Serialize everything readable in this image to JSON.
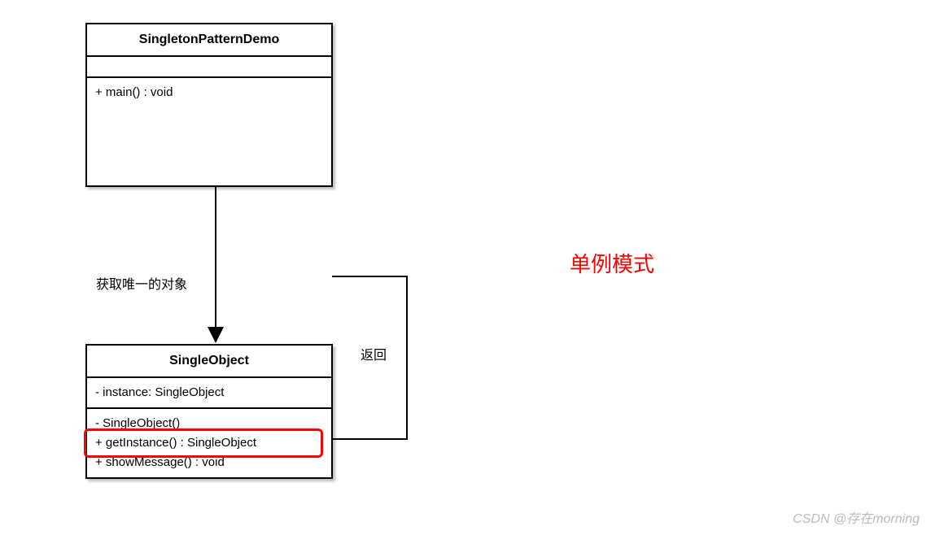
{
  "classes": {
    "demo": {
      "name": "SingletonPatternDemo",
      "attributes": "",
      "methods": [
        "+ main() : void"
      ]
    },
    "single": {
      "name": "SingleObject",
      "attributes": "- instance: SingleObject",
      "methods": [
        "- SingleObject()",
        "+ getInstance() : SingleObject",
        "+ showMessage() : void"
      ]
    }
  },
  "labels": {
    "edge_down": "获取唯一的对象",
    "edge_return": "返回",
    "title": "单例模式"
  },
  "watermark": "CSDN @存在morning"
}
